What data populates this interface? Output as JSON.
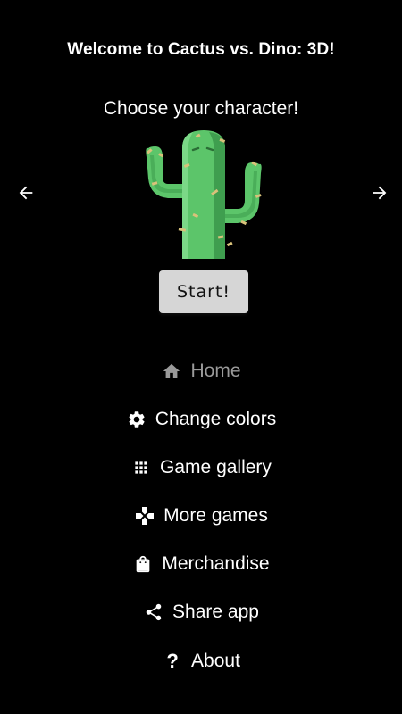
{
  "header": {
    "title": "Welcome to Cactus vs. Dino: 3D!",
    "subtitle": "Choose your character!"
  },
  "carousel": {
    "prev_icon": "arrow-left-icon",
    "next_icon": "arrow-right-icon",
    "character": "cactus"
  },
  "start_button": {
    "label": "Start!"
  },
  "menu": {
    "items": [
      {
        "label": "Home",
        "icon": "home-icon",
        "active": true
      },
      {
        "label": "Change colors",
        "icon": "gear-icon"
      },
      {
        "label": "Game gallery",
        "icon": "grid-icon"
      },
      {
        "label": "More games",
        "icon": "gamepad-icon"
      },
      {
        "label": "Merchandise",
        "icon": "shopping-bag-icon"
      },
      {
        "label": "Share app",
        "icon": "share-icon"
      },
      {
        "label": "About",
        "icon": "question-icon"
      }
    ]
  },
  "colors": {
    "background": "#000000",
    "text": "#ffffff",
    "dim_text": "#9a9a9a",
    "button": "#d6d6d6",
    "cactus_green": "#5cc56a",
    "cactus_dark": "#3f9e4f"
  }
}
